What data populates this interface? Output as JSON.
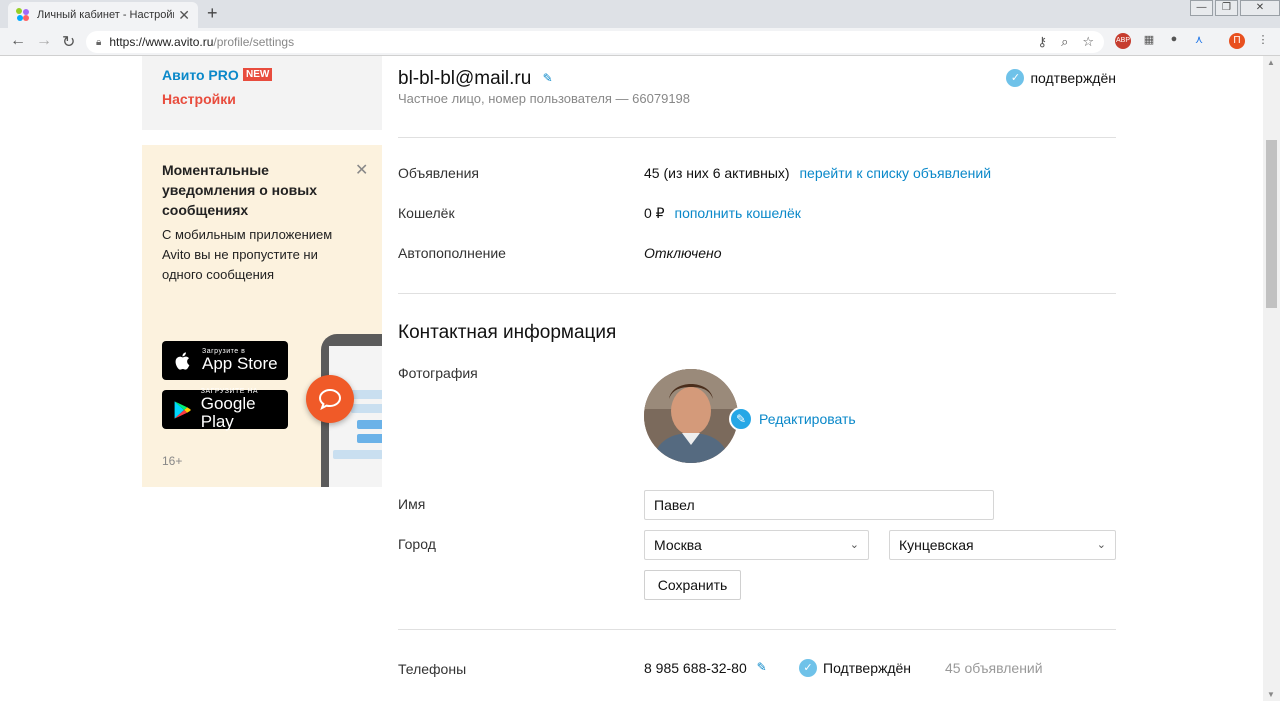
{
  "browser": {
    "tab_title": "Личный кабинет - Настройки - Ави",
    "tab_close": "✕",
    "new_tab": "+",
    "url_host": "https://www.avito.ru",
    "url_path": "/profile/settings",
    "avatar_letter": "П",
    "ext_badge": "ABP"
  },
  "sidenav": {
    "pro_label": "Авито PRO",
    "new_badge": "NEW",
    "settings_label": "Настройки"
  },
  "promo": {
    "title": "Моментальные уведомления о новых сообщениях",
    "text": "С мобильным приложением Avito вы не пропустите ни одного сообщения",
    "appstore_small": "Загрузите в",
    "appstore_big": "App Store",
    "googleplay_small": "ЗАГРУЗИТЕ НА",
    "googleplay_big": "Google Play",
    "age": "16+"
  },
  "profile": {
    "email": "bl-bl-bl@mail.ru",
    "subtitle": "Частное лицо, номер пользователя — 66079198",
    "confirmed": "подтверждён"
  },
  "stats": {
    "ads_label": "Объявления",
    "ads_value": "45 (из них 6 активных)",
    "ads_link": "перейти к списку объявлений",
    "wallet_label": "Кошелёк",
    "wallet_value": "0 ₽",
    "wallet_link": "пополнить кошелёк",
    "autofill_label": "Автопополнение",
    "autofill_value": "Отключено"
  },
  "contact": {
    "section_title": "Контактная информация",
    "photo_label": "Фотография",
    "edit_photo": "Редактировать",
    "name_label": "Имя",
    "name_value": "Павел",
    "city_label": "Город",
    "city_value": "Москва",
    "metro_value": "Кунцевская",
    "save_button": "Сохранить"
  },
  "phones": {
    "label": "Телефоны",
    "number": "8 985 688-32-80",
    "status": "Подтверждён",
    "ads_count": "45 объявлений"
  },
  "colors": {
    "link": "#0a88c9",
    "accent_red": "#e84c3d",
    "promo_bg": "#fcf2de",
    "confirm_badge": "#6fc2e9"
  }
}
